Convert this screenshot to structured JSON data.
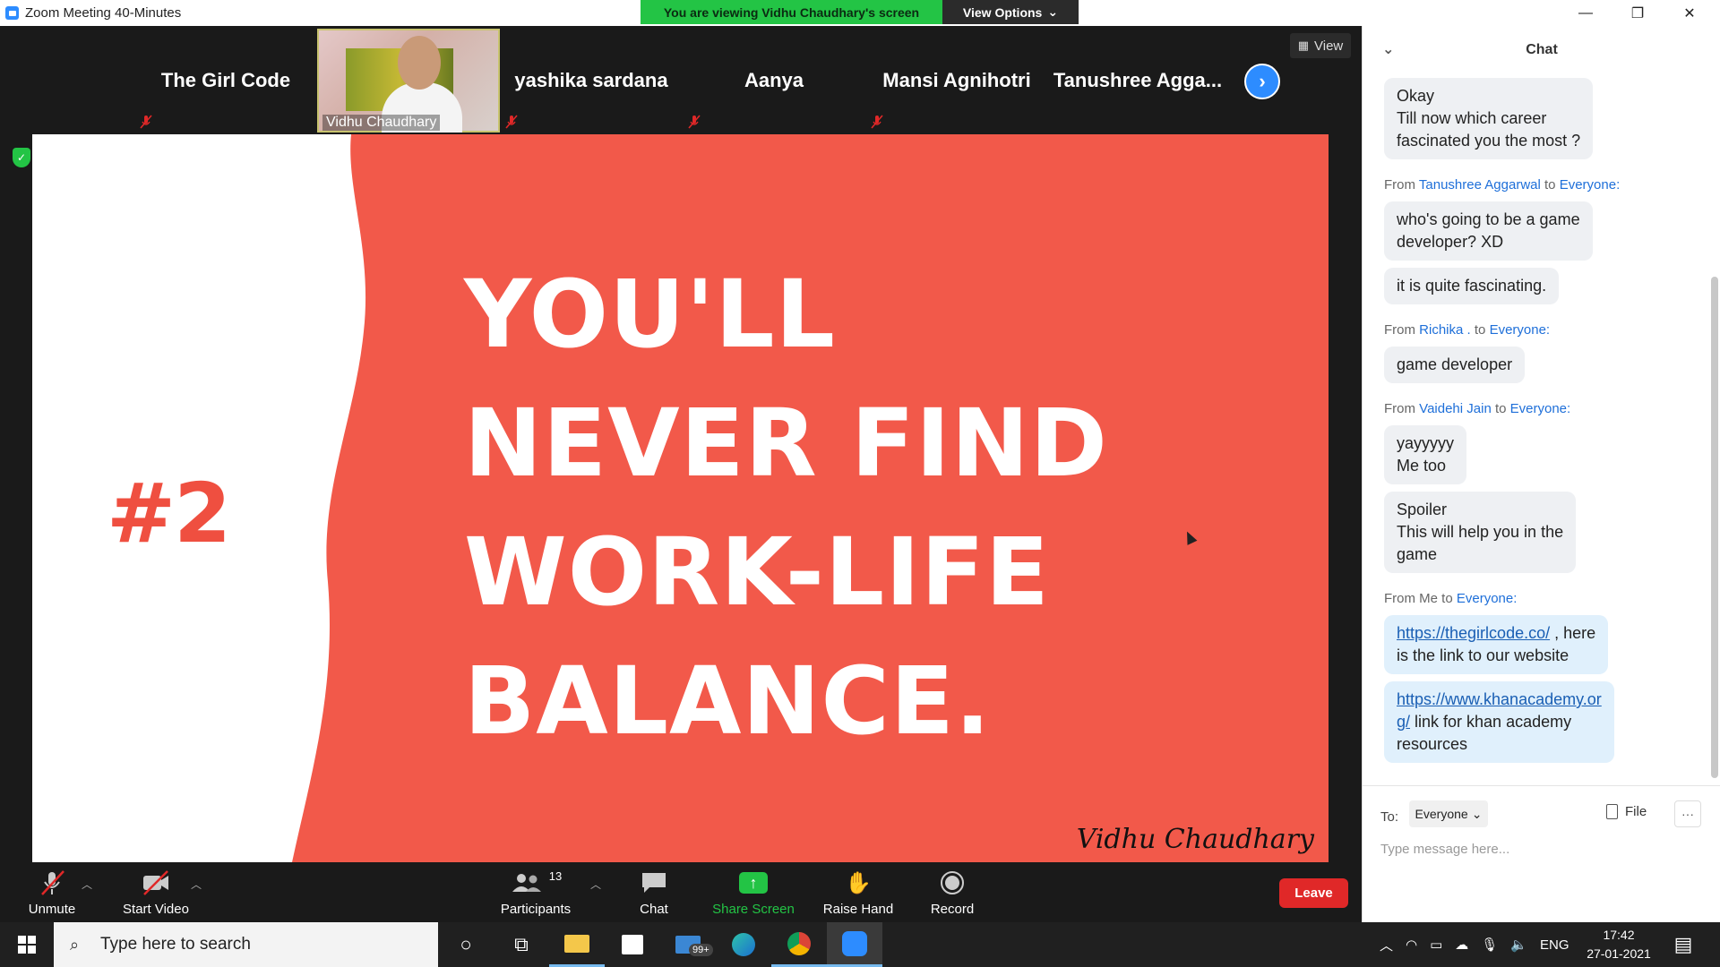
{
  "window": {
    "title": "Zoom Meeting 40-Minutes",
    "minimize": "—",
    "restore": "❐",
    "close": "✕"
  },
  "banner": {
    "viewing": "You are viewing Vidhu Chaudhary's screen",
    "view_options": "View Options"
  },
  "participants_strip": [
    {
      "name": "The Girl Code",
      "muted": true
    },
    {
      "name": "Vidhu Chaudhary",
      "muted": false,
      "video": true
    },
    {
      "name": "yashika sardana",
      "muted": true
    },
    {
      "name": "Aanya",
      "muted": true
    },
    {
      "name": "Mansi Agnihotri",
      "muted": true
    },
    {
      "name": "Tanushree  Agga...",
      "muted": false
    }
  ],
  "view_button": "View",
  "slide": {
    "number": "#2",
    "lines": [
      "YOU'LL",
      "NEVER FIND",
      "WORK-LIFE",
      "BALANCE."
    ],
    "signature": "Vidhu Chaudhary",
    "colors": {
      "background": "#f2594a",
      "left_panel": "#ffffff",
      "number": "#ef4f40"
    }
  },
  "toolbar": {
    "unmute": "Unmute",
    "start_video": "Start Video",
    "participants": "Participants",
    "participants_count": "13",
    "chat": "Chat",
    "share_screen": "Share Screen",
    "raise_hand": "Raise Hand",
    "record": "Record",
    "leave": "Leave"
  },
  "chat": {
    "title": "Chat",
    "messages": {
      "m1_line1": "Okay",
      "m1_line2": "Till now which career",
      "m1_line3": "fascinated you the most ?",
      "from1_prefix": "From ",
      "from1_name": "Tanushree Aggarwal",
      "from1_to": " to ",
      "from1_target": "Everyone:",
      "m2_line1": "who's going to be a game",
      "m2_line2": "developer? XD",
      "m3": "it is quite fascinating.",
      "from2_prefix": "From ",
      "from2_name": "Richika .",
      "from2_to": " to ",
      "from2_target": "Everyone:",
      "m4": "game developer",
      "from3_prefix": "From ",
      "from3_name": "Vaidehi Jain",
      "from3_to": " to ",
      "from3_target": "Everyone:",
      "m5_line1": "yayyyyy",
      "m5_line2": "Me too",
      "m6_line1": "Spoiler",
      "m6_line2": "This will help you in the",
      "m6_line3": "game",
      "from4_prefix": "From Me to ",
      "from4_target": "Everyone:",
      "m7_link": "https://thegirlcode.co/",
      "m7_rest1": " , here",
      "m7_rest2": "is the link to our website",
      "m8_link1": "https://www.khanacademy.or",
      "m8_link2": "g/",
      "m8_rest1": " link for khan academy",
      "m8_rest2": "resources"
    },
    "to_label": "To:",
    "recipient": "Everyone",
    "file_label": "File",
    "more": "···",
    "input_placeholder": "Type message here..."
  },
  "taskbar": {
    "search_placeholder": "Type here to search",
    "mail_badge": "99+",
    "language": "ENG",
    "time": "17:42",
    "date": "27-01-2021"
  },
  "colors": {
    "zoom_blue": "#2d8cff",
    "share_green": "#23c445",
    "leave_red": "#e02828",
    "link_blue": "#1e6fd9"
  }
}
